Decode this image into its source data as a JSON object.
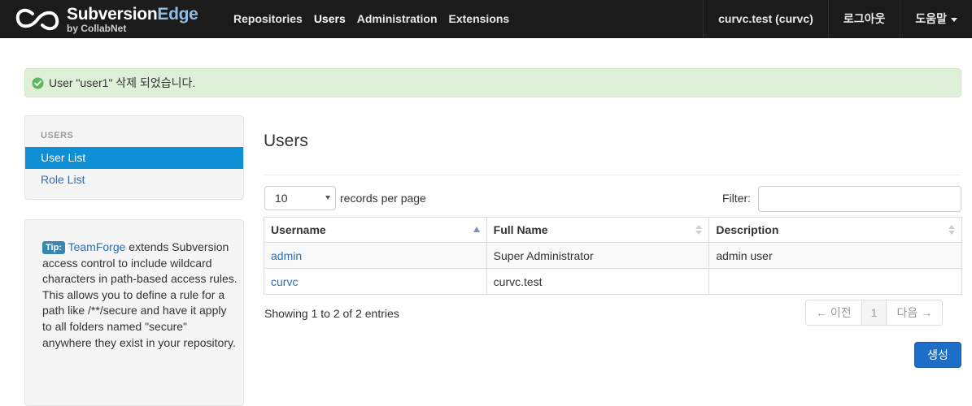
{
  "navbar": {
    "brand_name_main": "Subversion",
    "brand_name_accent": "Edge",
    "brand_sub": "by CollabNet",
    "links": [
      "Repositories",
      "Users",
      "Administration",
      "Extensions"
    ],
    "active_link": "Users",
    "user": "curvc.test (curvc)",
    "logout": "로그아웃",
    "help": "도움말"
  },
  "alert": {
    "message": "User \"user1\" 삭제 되었습니다.",
    "icon": "check-circle-icon",
    "color": "#dff0d8"
  },
  "sidebar": {
    "header": "USERS",
    "items": [
      {
        "label": "User List",
        "active": true
      },
      {
        "label": "Role List",
        "active": false
      }
    ]
  },
  "tip": {
    "badge": "Tip:",
    "link": "TeamForge",
    "text": " extends Subversion access control to include wildcard characters in path-based access rules. This allows you to define a rule for a path like /**/secure and have it apply to all folders named \"secure\" anywhere they exist in your repository."
  },
  "main": {
    "title": "Users",
    "length_value": "10",
    "length_label": "records per page",
    "filter_label": "Filter:",
    "filter_value": "",
    "columns": [
      "Username",
      "Full Name",
      "Description"
    ],
    "rows": [
      {
        "username": "admin",
        "full_name": "Super Administrator",
        "description": "admin user"
      },
      {
        "username": "curvc",
        "full_name": "curvc.test",
        "description": ""
      }
    ],
    "info": "Showing 1 to 2 of 2 entries",
    "pager": {
      "prev": "← 이전",
      "page": "1",
      "next": "다음 →"
    },
    "create_button": "생성"
  },
  "colors": {
    "navbar": "#1b1b1b",
    "active_item": "#0f8fd6",
    "link": "#2a6fb5",
    "primary_button": "#1c6ec8"
  }
}
